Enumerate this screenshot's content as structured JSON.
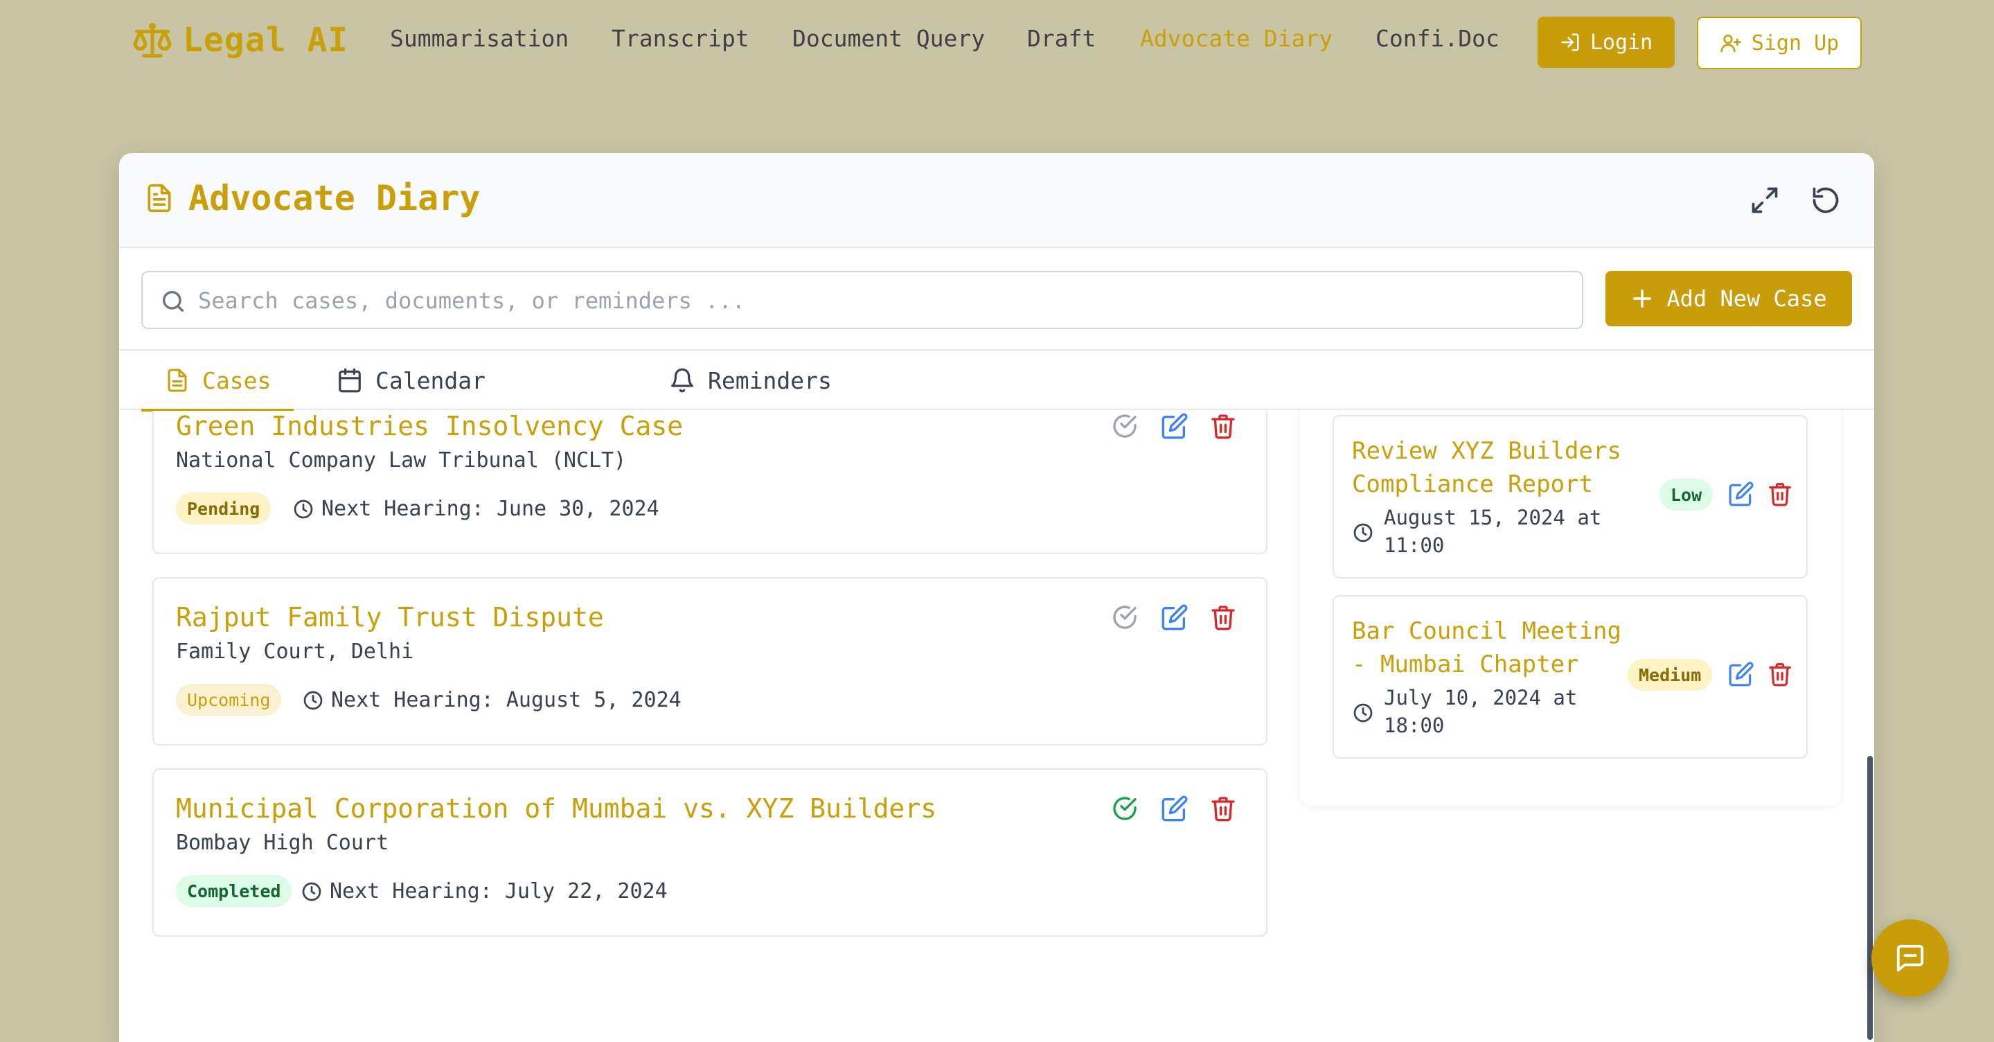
{
  "nav": {
    "brand": "Legal AI",
    "links": [
      "Summarisation",
      "Transcript",
      "Document Query",
      "Draft",
      "Advocate Diary",
      "Confi.Doc"
    ],
    "active": "Advocate Diary",
    "login_label": "Login",
    "signup_label": "Sign Up"
  },
  "diary": {
    "title": "Advocate Diary",
    "search_placeholder": "Search cases, documents, or reminders ...",
    "search_value": "",
    "add_case_label": "Add New Case",
    "tabs": [
      {
        "label": "Cases",
        "icon": "document-icon",
        "active": true
      },
      {
        "label": "Calendar",
        "icon": "calendar-icon",
        "active": false
      },
      {
        "label": "Reminders",
        "icon": "bell-icon",
        "active": false
      }
    ]
  },
  "cases": [
    {
      "title": "Green Industries Insolvency Case",
      "court": "National Company Law Tribunal (NCLT)",
      "status": "Pending",
      "hearing": "Next Hearing: June 30, 2024",
      "done": false
    },
    {
      "title": "Rajput Family Trust Dispute",
      "court": "Family Court, Delhi",
      "status": "Upcoming",
      "hearing": "Next Hearing: August 5, 2024",
      "done": false
    },
    {
      "title": "Municipal Corporation of Mumbai vs. XYZ Builders",
      "court": "Bombay High Court",
      "status": "Completed",
      "hearing": "Next Hearing: July 22, 2024",
      "done": true
    }
  ],
  "reminders": [
    {
      "title": "Review XYZ Builders Compliance Report",
      "time": "August 15, 2024 at 11:00",
      "priority": "Low"
    },
    {
      "title": "Bar Council Meeting - Mumbai Chapter",
      "time": "July 10, 2024 at 18:00",
      "priority": "Medium"
    }
  ],
  "colors": {
    "accent": "#c9a00a",
    "background": "#c8c4a4",
    "edit": "#3b82f6",
    "delete": "#dc2626",
    "done": "#16a34a"
  }
}
